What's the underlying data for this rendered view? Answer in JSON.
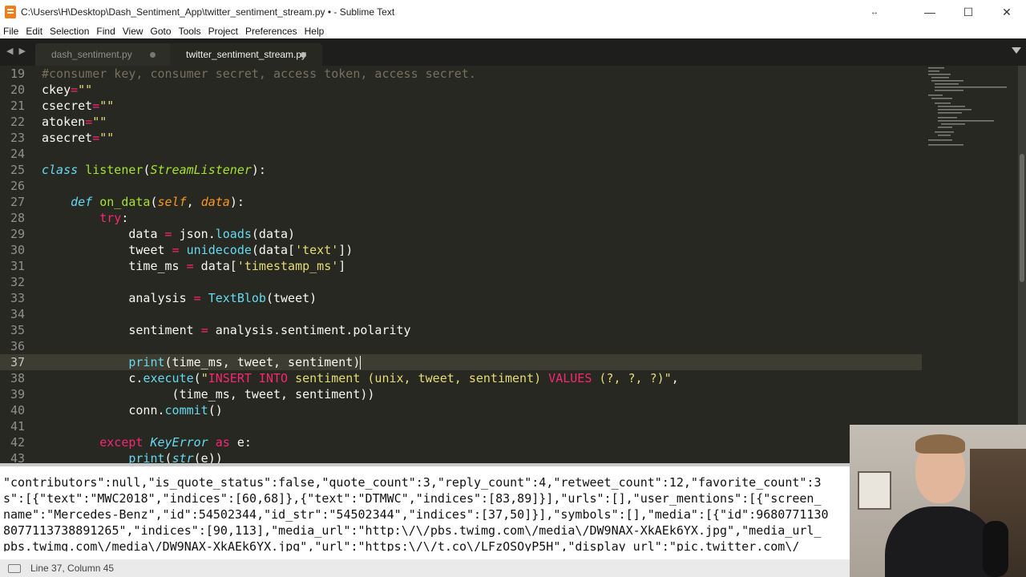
{
  "window": {
    "title": "C:\\Users\\H\\Desktop\\Dash_Sentiment_App\\twitter_sentiment_stream.py • - Sublime Text",
    "controls": {
      "resize": "↔",
      "minimize": "—",
      "maximize": "☐",
      "close": "✕"
    }
  },
  "menu": [
    "File",
    "Edit",
    "Selection",
    "Find",
    "View",
    "Goto",
    "Tools",
    "Project",
    "Preferences",
    "Help"
  ],
  "tabs": [
    {
      "label": "dash_sentiment.py",
      "active": false,
      "modified": true
    },
    {
      "label": "twitter_sentiment_stream.py",
      "active": true,
      "modified": true
    }
  ],
  "tabnav_glyph": "◀ ▶",
  "editor": {
    "current_line": 37,
    "lines": [
      {
        "n": "19",
        "tokens": [
          {
            "c": "cm",
            "t": "#consumer key, consumer secret, access token, access secret."
          }
        ]
      },
      {
        "n": "20",
        "tokens": [
          {
            "c": "tx",
            "t": "ckey"
          },
          {
            "c": "kw",
            "t": "="
          },
          {
            "c": "st",
            "t": "\"\""
          }
        ]
      },
      {
        "n": "21",
        "tokens": [
          {
            "c": "tx",
            "t": "csecret"
          },
          {
            "c": "kw",
            "t": "="
          },
          {
            "c": "st",
            "t": "\"\""
          }
        ]
      },
      {
        "n": "22",
        "tokens": [
          {
            "c": "tx",
            "t": "atoken"
          },
          {
            "c": "kw",
            "t": "="
          },
          {
            "c": "st",
            "t": "\"\""
          }
        ]
      },
      {
        "n": "23",
        "tokens": [
          {
            "c": "tx",
            "t": "asecret"
          },
          {
            "c": "kw",
            "t": "="
          },
          {
            "c": "st",
            "t": "\"\""
          }
        ]
      },
      {
        "n": "24",
        "tokens": []
      },
      {
        "n": "25",
        "tokens": [
          {
            "c": "ki",
            "t": "class"
          },
          {
            "c": "tx",
            "t": " "
          },
          {
            "c": "fn",
            "t": "listener"
          },
          {
            "c": "tx",
            "t": "("
          },
          {
            "c": "cl",
            "t": "StreamListener"
          },
          {
            "c": "tx",
            "t": "):"
          }
        ]
      },
      {
        "n": "26",
        "tokens": []
      },
      {
        "n": "27",
        "tokens": [
          {
            "c": "tx",
            "t": "    "
          },
          {
            "c": "ki",
            "t": "def"
          },
          {
            "c": "tx",
            "t": " "
          },
          {
            "c": "fn",
            "t": "on_data"
          },
          {
            "c": "tx",
            "t": "("
          },
          {
            "c": "pa",
            "t": "self"
          },
          {
            "c": "tx",
            "t": ", "
          },
          {
            "c": "pa",
            "t": "data"
          },
          {
            "c": "tx",
            "t": "):"
          }
        ]
      },
      {
        "n": "28",
        "tokens": [
          {
            "c": "tx",
            "t": "        "
          },
          {
            "c": "kw",
            "t": "try"
          },
          {
            "c": "tx",
            "t": ":"
          }
        ]
      },
      {
        "n": "29",
        "tokens": [
          {
            "c": "tx",
            "t": "            data "
          },
          {
            "c": "kw",
            "t": "="
          },
          {
            "c": "tx",
            "t": " json."
          },
          {
            "c": "bi",
            "t": "loads"
          },
          {
            "c": "tx",
            "t": "(data)"
          }
        ]
      },
      {
        "n": "30",
        "tokens": [
          {
            "c": "tx",
            "t": "            tweet "
          },
          {
            "c": "kw",
            "t": "="
          },
          {
            "c": "tx",
            "t": " "
          },
          {
            "c": "bi",
            "t": "unidecode"
          },
          {
            "c": "tx",
            "t": "(data["
          },
          {
            "c": "st",
            "t": "'text'"
          },
          {
            "c": "tx",
            "t": "])"
          }
        ]
      },
      {
        "n": "31",
        "tokens": [
          {
            "c": "tx",
            "t": "            time_ms "
          },
          {
            "c": "kw",
            "t": "="
          },
          {
            "c": "tx",
            "t": " data["
          },
          {
            "c": "st",
            "t": "'timestamp_ms'"
          },
          {
            "c": "tx",
            "t": "]"
          }
        ]
      },
      {
        "n": "32",
        "tokens": []
      },
      {
        "n": "33",
        "tokens": [
          {
            "c": "tx",
            "t": "            analysis "
          },
          {
            "c": "kw",
            "t": "="
          },
          {
            "c": "tx",
            "t": " "
          },
          {
            "c": "bi",
            "t": "TextBlob"
          },
          {
            "c": "tx",
            "t": "(tweet)"
          }
        ]
      },
      {
        "n": "34",
        "tokens": []
      },
      {
        "n": "35",
        "tokens": [
          {
            "c": "tx",
            "t": "            sentiment "
          },
          {
            "c": "kw",
            "t": "="
          },
          {
            "c": "tx",
            "t": " analysis.sentiment.polarity"
          }
        ]
      },
      {
        "n": "36",
        "tokens": []
      },
      {
        "n": "37",
        "tokens": [
          {
            "c": "tx",
            "t": "            "
          },
          {
            "c": "bi",
            "t": "print"
          },
          {
            "c": "tx",
            "t": "(time_ms, tweet, sentiment)"
          }
        ]
      },
      {
        "n": "38",
        "tokens": [
          {
            "c": "tx",
            "t": "            c."
          },
          {
            "c": "bi",
            "t": "execute"
          },
          {
            "c": "tx",
            "t": "("
          },
          {
            "c": "st",
            "t": "\""
          },
          {
            "c": "kw",
            "t": "INSERT INTO"
          },
          {
            "c": "st",
            "t": " sentiment (unix, tweet, sentiment) "
          },
          {
            "c": "kw",
            "t": "VALUES"
          },
          {
            "c": "st",
            "t": " (?, ?, ?)\""
          },
          {
            "c": "tx",
            "t": ","
          }
        ]
      },
      {
        "n": "39",
        "tokens": [
          {
            "c": "tx",
            "t": "                  (time_ms, tweet, sentiment))"
          }
        ]
      },
      {
        "n": "40",
        "tokens": [
          {
            "c": "tx",
            "t": "            conn."
          },
          {
            "c": "bi",
            "t": "commit"
          },
          {
            "c": "tx",
            "t": "()"
          }
        ]
      },
      {
        "n": "41",
        "tokens": []
      },
      {
        "n": "42",
        "tokens": [
          {
            "c": "tx",
            "t": "        "
          },
          {
            "c": "kw",
            "t": "except"
          },
          {
            "c": "tx",
            "t": " "
          },
          {
            "c": "ex",
            "t": "KeyError"
          },
          {
            "c": "tx",
            "t": " "
          },
          {
            "c": "kw",
            "t": "as"
          },
          {
            "c": "tx",
            "t": " e:"
          }
        ]
      },
      {
        "n": "43",
        "tokens": [
          {
            "c": "tx",
            "t": "            "
          },
          {
            "c": "bi",
            "t": "print"
          },
          {
            "c": "tx",
            "t": "("
          },
          {
            "c": "ex",
            "t": "str"
          },
          {
            "c": "tx",
            "t": "(e))"
          }
        ]
      }
    ]
  },
  "console": {
    "lines": [
      "\"contributors\":null,\"is_quote_status\":false,\"quote_count\":3,\"reply_count\":4,\"retweet_count\":12,\"favorite_count\":3",
      "s\":[{\"text\":\"MWC2018\",\"indices\":[60,68]},{\"text\":\"DTMWC\",\"indices\":[83,89]}],\"urls\":[],\"user_mentions\":[{\"screen_",
      "name\":\"Mercedes-Benz\",\"id\":54502344,\"id_str\":\"54502344\",\"indices\":[37,50]}],\"symbols\":[],\"media\":[{\"id\":9680771130",
      "8077113738891265\",\"indices\":[90,113],\"media_url\":\"http:\\/\\/pbs.twimg.com\\/media\\/DW9NAX-XkAEk6YX.jpg\",\"media_url_",
      "pbs.twimg.com\\/media\\/DW9NAX-XkAEk6YX.jpg\",\"url\":\"https:\\/\\/t.co\\/LFzOSOyP5H\",\"display_url\":\"pic.twitter.com\\/"
    ]
  },
  "status": {
    "position": "Line 37, Column 45"
  }
}
